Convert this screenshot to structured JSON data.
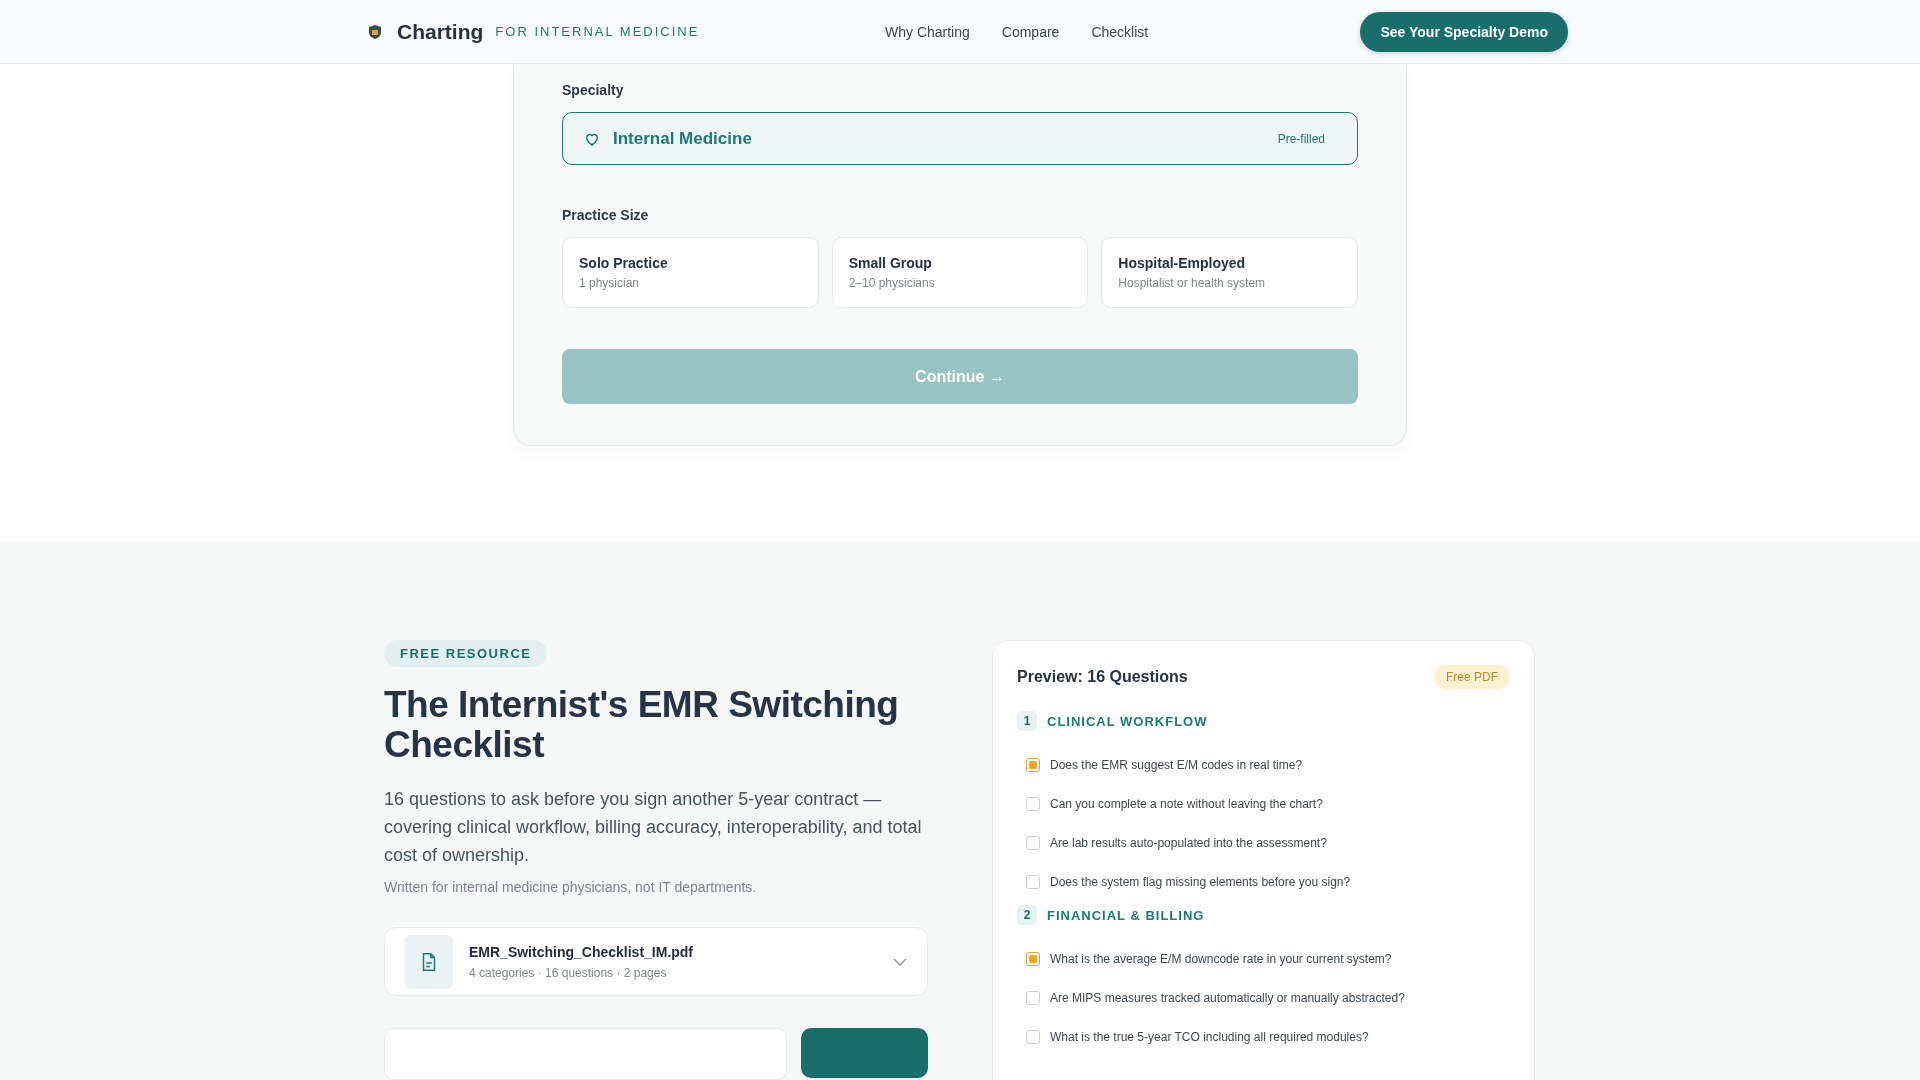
{
  "header": {
    "brand": "Charting",
    "tagline": "FOR INTERNAL MEDICINE",
    "nav": [
      "Why Charting",
      "Compare",
      "Checklist"
    ],
    "cta": "See Your Specialty Demo"
  },
  "form": {
    "specialty_label": "Specialty",
    "specialty_value": "Internal Medicine",
    "specialty_note": "Pre-filled",
    "size_label": "Practice Size",
    "sizes": [
      {
        "title": "Solo Practice",
        "subtitle": "1 physician",
        "selected": false
      },
      {
        "title": "Small Group",
        "subtitle": "2–10 physicians",
        "selected": false
      },
      {
        "title": "Hospital-Employed",
        "subtitle": "Hospitalist or health system",
        "selected": false
      }
    ],
    "continue": {
      "label": "Continue →",
      "disabled": true
    }
  },
  "resource": {
    "badge": "FREE RESOURCE",
    "title": "The Internist's EMR Switching Checklist",
    "description": "16 questions to ask before you sign another 5-year contract — covering clinical workflow, billing accuracy, interoperability, and total cost of ownership.",
    "note": "Written for internal medicine physicians, not IT departments.",
    "file": {
      "name": "EMR_Switching_Checklist_IM.pdf",
      "meta": "4 categories · 16 questions · 2 pages",
      "expanded": false
    }
  },
  "preview": {
    "title": "Preview: 16 Questions",
    "badge": "Free PDF",
    "categories": [
      {
        "number": "1",
        "name": "CLINICAL WORKFLOW",
        "questions": [
          {
            "text": "Does the EMR suggest E/M codes in real time?",
            "checked": true
          },
          {
            "text": "Can you complete a note without leaving the chart?",
            "checked": false
          },
          {
            "text": "Are lab results auto-populated into the assessment?",
            "checked": false
          },
          {
            "text": "Does the system flag missing elements before you sign?",
            "checked": false
          }
        ]
      },
      {
        "number": "2",
        "name": "FINANCIAL & BILLING",
        "questions": [
          {
            "text": "What is the average E/M downcode rate in your current system?",
            "checked": true
          },
          {
            "text": "Are MIPS measures tracked automatically or manually abstracted?",
            "checked": false
          },
          {
            "text": "What is the true 5-year TCO including all required modules?",
            "checked": false
          }
        ]
      }
    ]
  }
}
